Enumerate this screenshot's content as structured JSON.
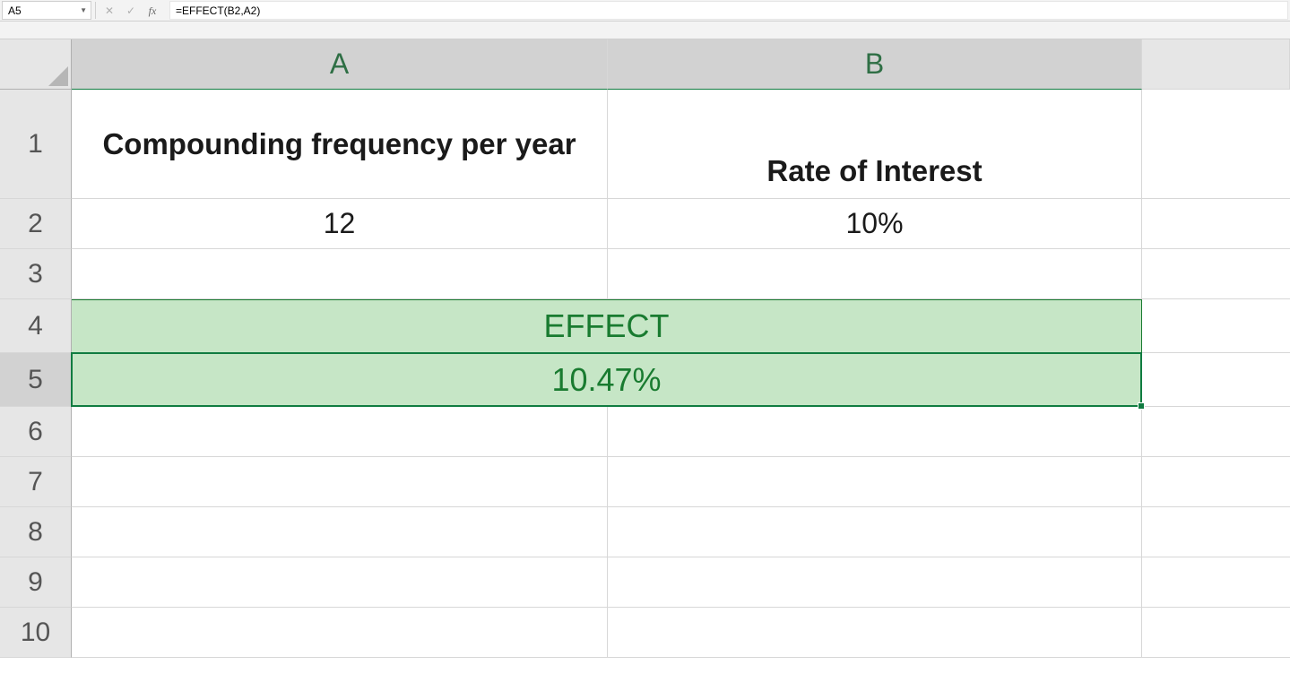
{
  "formula_bar": {
    "name_box_value": "A5",
    "formula_value": "=EFFECT(B2,A2)",
    "cancel_icon": "✕",
    "accept_icon": "✓",
    "fx_label": "fx"
  },
  "columns": {
    "A": "A",
    "B": "B"
  },
  "row_labels": [
    "1",
    "2",
    "3",
    "4",
    "5",
    "6",
    "7",
    "8",
    "9",
    "10"
  ],
  "cells": {
    "A1": "Compounding frequency per year",
    "B1": "Rate of Interest",
    "A2": "12",
    "B2": "10%",
    "merged4": "EFFECT",
    "merged5": "10.47%"
  },
  "selection": {
    "active_cell": "A5"
  }
}
